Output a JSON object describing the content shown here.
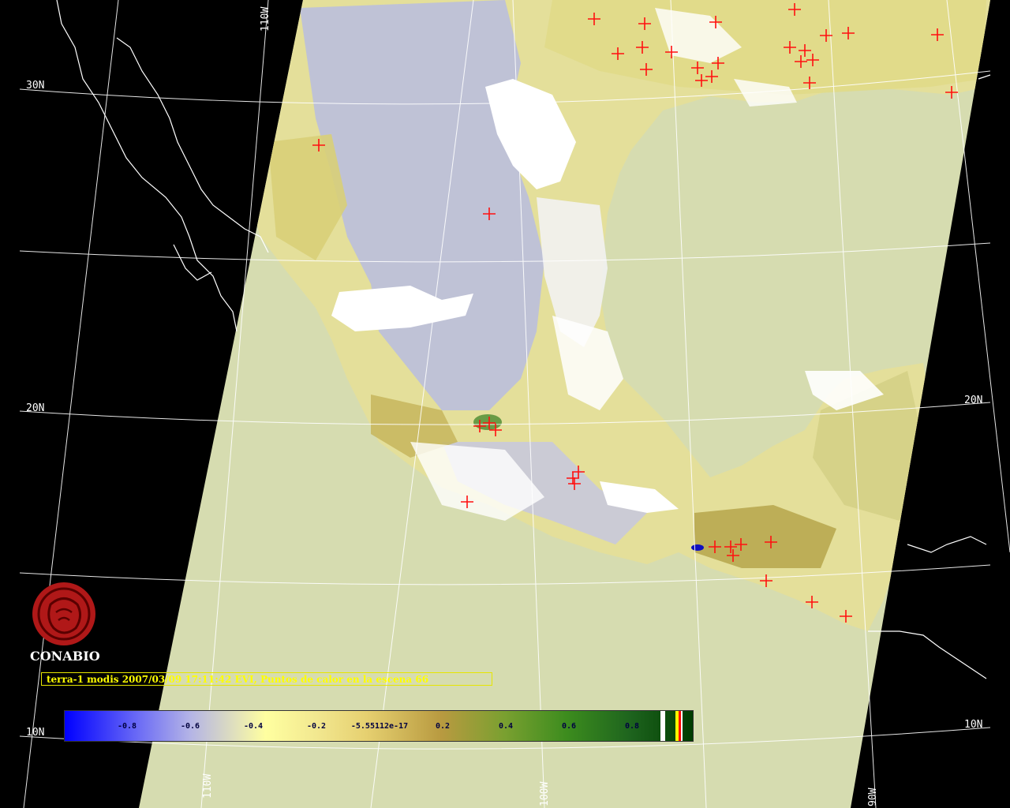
{
  "map": {
    "latitude_labels": [
      "30N",
      "20N",
      "10N"
    ],
    "longitude_labels": [
      "110W",
      "100W",
      "90W"
    ],
    "point_marker": "red-plus",
    "colors": {
      "background": "#000000",
      "swath": "#d6dcb0",
      "coastline": "#ffffff",
      "graticule": "#ffffff",
      "hotspot": "#ff0000",
      "cloud": "#ffffff"
    }
  },
  "caption": "terra-1 modis 2007/03/09 17:11:42 EVI, Puntos de calor en la escena 66",
  "logo": {
    "text": "CONABIO",
    "icon": "conabio-logo-icon",
    "color": "#b01818"
  },
  "colorbar": {
    "ticks": [
      "-0.8",
      "-0.6",
      "-0.4",
      "-0.2",
      "-5.55112e-17",
      "0.2",
      "0.4",
      "0.6",
      "0.8"
    ]
  }
}
